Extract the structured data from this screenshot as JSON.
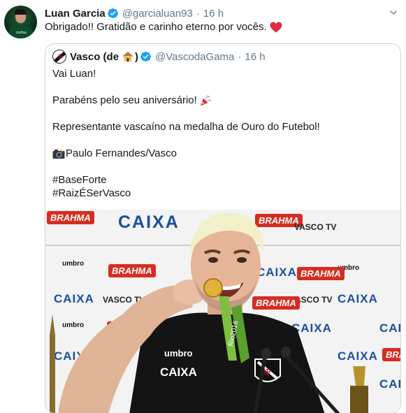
{
  "tweet": {
    "author_name": "Luan Garcia",
    "handle": "@garcialuan93",
    "separator": "·",
    "time": "16 h",
    "text": "Obrigado!! Gratidão e carinho eterno por vocês.",
    "text_emoji": "heart-emoji"
  },
  "avatar": {
    "logo_text": "crefisa"
  },
  "quoted": {
    "author_name": "Vasco (de",
    "name_emoji": "house-emoji",
    "name_close": ")",
    "handle": "@VascodaGama",
    "separator": "·",
    "time": "16 h",
    "lines": {
      "l1": "Vai Luan!",
      "l2": "Parabéns pelo seu aniversário!",
      "l3": "Representante vascaíno na medalha de Ouro do Futebol!",
      "l4": "Paulo Fernandes/Vasco",
      "l5": "#BaseForte",
      "l6": "#RaizÉSerVasco"
    },
    "photo": {
      "sponsors": {
        "brahma": "BRAHMA",
        "caixa": "CAIXA",
        "umbro": "umbro",
        "vascotv": "VASCO TV"
      },
      "shirt_umbro": "umbro",
      "shirt_caixa": "CAIXA",
      "medal_ribbon": "Rio2016"
    }
  },
  "colors": {
    "verified_blue": "#1da1f2",
    "text": "#14171a",
    "muted": "#657786",
    "border": "#ccd6dd",
    "heart_red": "#e0245e"
  }
}
